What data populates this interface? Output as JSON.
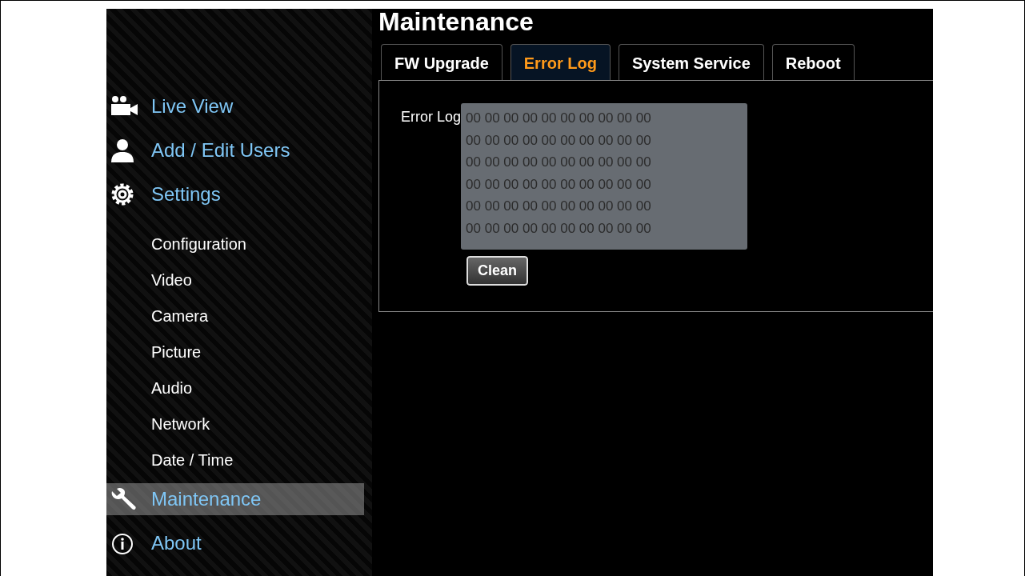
{
  "page_title": "Maintenance",
  "sidebar": {
    "items": [
      {
        "kind": "main",
        "label": "Live View",
        "selected": false
      },
      {
        "kind": "main",
        "label": "Add / Edit Users",
        "selected": false
      },
      {
        "kind": "main",
        "label": "Settings",
        "selected": false
      },
      {
        "kind": "sub",
        "label": "Configuration",
        "selected": false
      },
      {
        "kind": "sub",
        "label": "Video",
        "selected": false
      },
      {
        "kind": "sub",
        "label": "Camera",
        "selected": false
      },
      {
        "kind": "sub",
        "label": "Picture",
        "selected": false
      },
      {
        "kind": "sub",
        "label": "Audio",
        "selected": false
      },
      {
        "kind": "sub",
        "label": "Network",
        "selected": false
      },
      {
        "kind": "sub",
        "label": "Date / Time",
        "selected": false
      },
      {
        "kind": "main",
        "label": "Maintenance",
        "selected": true
      },
      {
        "kind": "main",
        "label": "About",
        "selected": false
      }
    ]
  },
  "tabs": [
    {
      "label": "FW Upgrade",
      "selected": false
    },
    {
      "label": "Error Log",
      "selected": true
    },
    {
      "label": "System Service",
      "selected": false
    },
    {
      "label": "Reboot",
      "selected": false
    }
  ],
  "error_log": {
    "label": "Error Log",
    "lines": [
      "00 00 00 00 00 00 00 00 00 00",
      "00 00 00 00 00 00 00 00 00 00",
      "00 00 00 00 00 00 00 00 00 00",
      "00 00 00 00 00 00 00 00 00 00",
      "00 00 00 00 00 00 00 00 00 00",
      "00 00 00 00 00 00 00 00 00 00"
    ]
  },
  "clean_button": "Clean"
}
